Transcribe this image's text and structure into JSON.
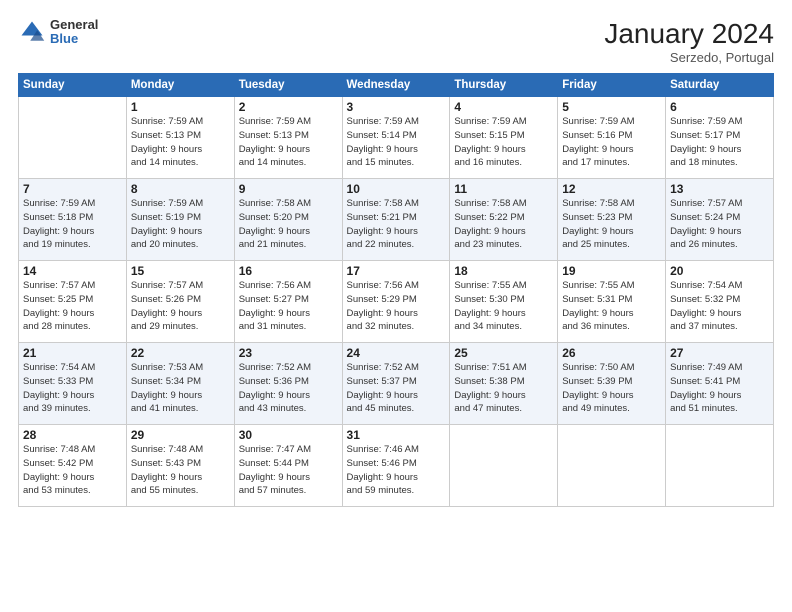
{
  "header": {
    "logo_general": "General",
    "logo_blue": "Blue",
    "month_title": "January 2024",
    "location": "Serzedo, Portugal"
  },
  "days_of_week": [
    "Sunday",
    "Monday",
    "Tuesday",
    "Wednesday",
    "Thursday",
    "Friday",
    "Saturday"
  ],
  "weeks": [
    [
      {
        "day": "",
        "info": ""
      },
      {
        "day": "1",
        "info": "Sunrise: 7:59 AM\nSunset: 5:13 PM\nDaylight: 9 hours\nand 14 minutes."
      },
      {
        "day": "2",
        "info": "Sunrise: 7:59 AM\nSunset: 5:13 PM\nDaylight: 9 hours\nand 14 minutes."
      },
      {
        "day": "3",
        "info": "Sunrise: 7:59 AM\nSunset: 5:14 PM\nDaylight: 9 hours\nand 15 minutes."
      },
      {
        "day": "4",
        "info": "Sunrise: 7:59 AM\nSunset: 5:15 PM\nDaylight: 9 hours\nand 16 minutes."
      },
      {
        "day": "5",
        "info": "Sunrise: 7:59 AM\nSunset: 5:16 PM\nDaylight: 9 hours\nand 17 minutes."
      },
      {
        "day": "6",
        "info": "Sunrise: 7:59 AM\nSunset: 5:17 PM\nDaylight: 9 hours\nand 18 minutes."
      }
    ],
    [
      {
        "day": "7",
        "info": "Sunrise: 7:59 AM\nSunset: 5:18 PM\nDaylight: 9 hours\nand 19 minutes."
      },
      {
        "day": "8",
        "info": "Sunrise: 7:59 AM\nSunset: 5:19 PM\nDaylight: 9 hours\nand 20 minutes."
      },
      {
        "day": "9",
        "info": "Sunrise: 7:58 AM\nSunset: 5:20 PM\nDaylight: 9 hours\nand 21 minutes."
      },
      {
        "day": "10",
        "info": "Sunrise: 7:58 AM\nSunset: 5:21 PM\nDaylight: 9 hours\nand 22 minutes."
      },
      {
        "day": "11",
        "info": "Sunrise: 7:58 AM\nSunset: 5:22 PM\nDaylight: 9 hours\nand 23 minutes."
      },
      {
        "day": "12",
        "info": "Sunrise: 7:58 AM\nSunset: 5:23 PM\nDaylight: 9 hours\nand 25 minutes."
      },
      {
        "day": "13",
        "info": "Sunrise: 7:57 AM\nSunset: 5:24 PM\nDaylight: 9 hours\nand 26 minutes."
      }
    ],
    [
      {
        "day": "14",
        "info": "Sunrise: 7:57 AM\nSunset: 5:25 PM\nDaylight: 9 hours\nand 28 minutes."
      },
      {
        "day": "15",
        "info": "Sunrise: 7:57 AM\nSunset: 5:26 PM\nDaylight: 9 hours\nand 29 minutes."
      },
      {
        "day": "16",
        "info": "Sunrise: 7:56 AM\nSunset: 5:27 PM\nDaylight: 9 hours\nand 31 minutes."
      },
      {
        "day": "17",
        "info": "Sunrise: 7:56 AM\nSunset: 5:29 PM\nDaylight: 9 hours\nand 32 minutes."
      },
      {
        "day": "18",
        "info": "Sunrise: 7:55 AM\nSunset: 5:30 PM\nDaylight: 9 hours\nand 34 minutes."
      },
      {
        "day": "19",
        "info": "Sunrise: 7:55 AM\nSunset: 5:31 PM\nDaylight: 9 hours\nand 36 minutes."
      },
      {
        "day": "20",
        "info": "Sunrise: 7:54 AM\nSunset: 5:32 PM\nDaylight: 9 hours\nand 37 minutes."
      }
    ],
    [
      {
        "day": "21",
        "info": "Sunrise: 7:54 AM\nSunset: 5:33 PM\nDaylight: 9 hours\nand 39 minutes."
      },
      {
        "day": "22",
        "info": "Sunrise: 7:53 AM\nSunset: 5:34 PM\nDaylight: 9 hours\nand 41 minutes."
      },
      {
        "day": "23",
        "info": "Sunrise: 7:52 AM\nSunset: 5:36 PM\nDaylight: 9 hours\nand 43 minutes."
      },
      {
        "day": "24",
        "info": "Sunrise: 7:52 AM\nSunset: 5:37 PM\nDaylight: 9 hours\nand 45 minutes."
      },
      {
        "day": "25",
        "info": "Sunrise: 7:51 AM\nSunset: 5:38 PM\nDaylight: 9 hours\nand 47 minutes."
      },
      {
        "day": "26",
        "info": "Sunrise: 7:50 AM\nSunset: 5:39 PM\nDaylight: 9 hours\nand 49 minutes."
      },
      {
        "day": "27",
        "info": "Sunrise: 7:49 AM\nSunset: 5:41 PM\nDaylight: 9 hours\nand 51 minutes."
      }
    ],
    [
      {
        "day": "28",
        "info": "Sunrise: 7:48 AM\nSunset: 5:42 PM\nDaylight: 9 hours\nand 53 minutes."
      },
      {
        "day": "29",
        "info": "Sunrise: 7:48 AM\nSunset: 5:43 PM\nDaylight: 9 hours\nand 55 minutes."
      },
      {
        "day": "30",
        "info": "Sunrise: 7:47 AM\nSunset: 5:44 PM\nDaylight: 9 hours\nand 57 minutes."
      },
      {
        "day": "31",
        "info": "Sunrise: 7:46 AM\nSunset: 5:46 PM\nDaylight: 9 hours\nand 59 minutes."
      },
      {
        "day": "",
        "info": ""
      },
      {
        "day": "",
        "info": ""
      },
      {
        "day": "",
        "info": ""
      }
    ]
  ]
}
